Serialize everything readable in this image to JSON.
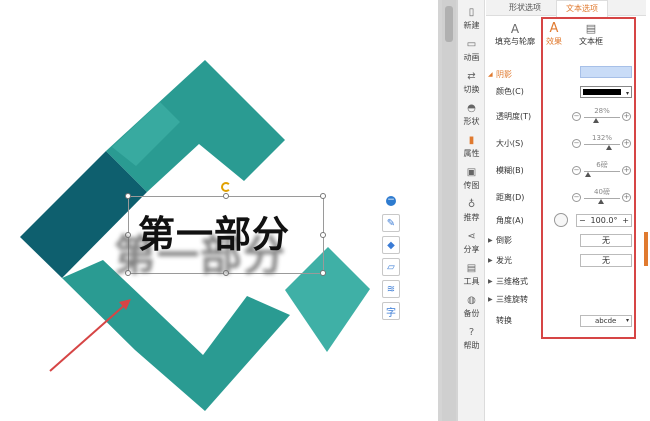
{
  "panel": {
    "tabs": {
      "shape_options": "形状选项",
      "text_options": "文本选项"
    },
    "fill_outline": "填充与轮廓",
    "subtabs": {
      "effect": "效果",
      "textbox": "文本框"
    },
    "shadow_section": "阴影",
    "rows": {
      "color": "颜色(C)",
      "transparency": "透明度(T)",
      "size": "大小(S)",
      "blur": "模糊(B)",
      "distance": "距离(D)",
      "angle": "角度(A)",
      "reflection": "倒影",
      "glow": "发光",
      "3d_format": "三维格式",
      "3d_rotation": "三维旋转",
      "transform": "转换"
    },
    "values": {
      "transparency": "28%",
      "size": "132%",
      "blur": "6磅",
      "distance": "40磅",
      "angle": "100.0°",
      "reflection": "无",
      "glow": "无",
      "transform": "abcde"
    },
    "sliders": {
      "transparency": 0.28,
      "size": 0.66,
      "blur": 0.06,
      "distance": 0.4
    },
    "colors": {
      "shadow_color": "#000000",
      "accent": "#e07a2f",
      "highlight_box": "#d64545"
    }
  },
  "side_strip": [
    {
      "label": "新建",
      "icon": "new-file-icon"
    },
    {
      "label": "动画",
      "icon": "animation-icon"
    },
    {
      "label": "切换",
      "icon": "transition-icon"
    },
    {
      "label": "形状",
      "icon": "shapes-icon"
    },
    {
      "label": "属性",
      "icon": "properties-icon"
    },
    {
      "label": "传图",
      "icon": "picture-icon"
    },
    {
      "label": "推荐",
      "icon": "recommend-icon"
    },
    {
      "label": "分享",
      "icon": "share-icon"
    },
    {
      "label": "工具",
      "icon": "toolbox-icon"
    },
    {
      "label": "备份",
      "icon": "backup-icon"
    },
    {
      "label": "帮助",
      "icon": "help-icon"
    }
  ],
  "slide": {
    "title_text": "第一部分",
    "colors": {
      "teal_light": "#3fb0a6",
      "teal_mid": "#2a9b92",
      "teal_dark": "#0e5f6e"
    }
  }
}
